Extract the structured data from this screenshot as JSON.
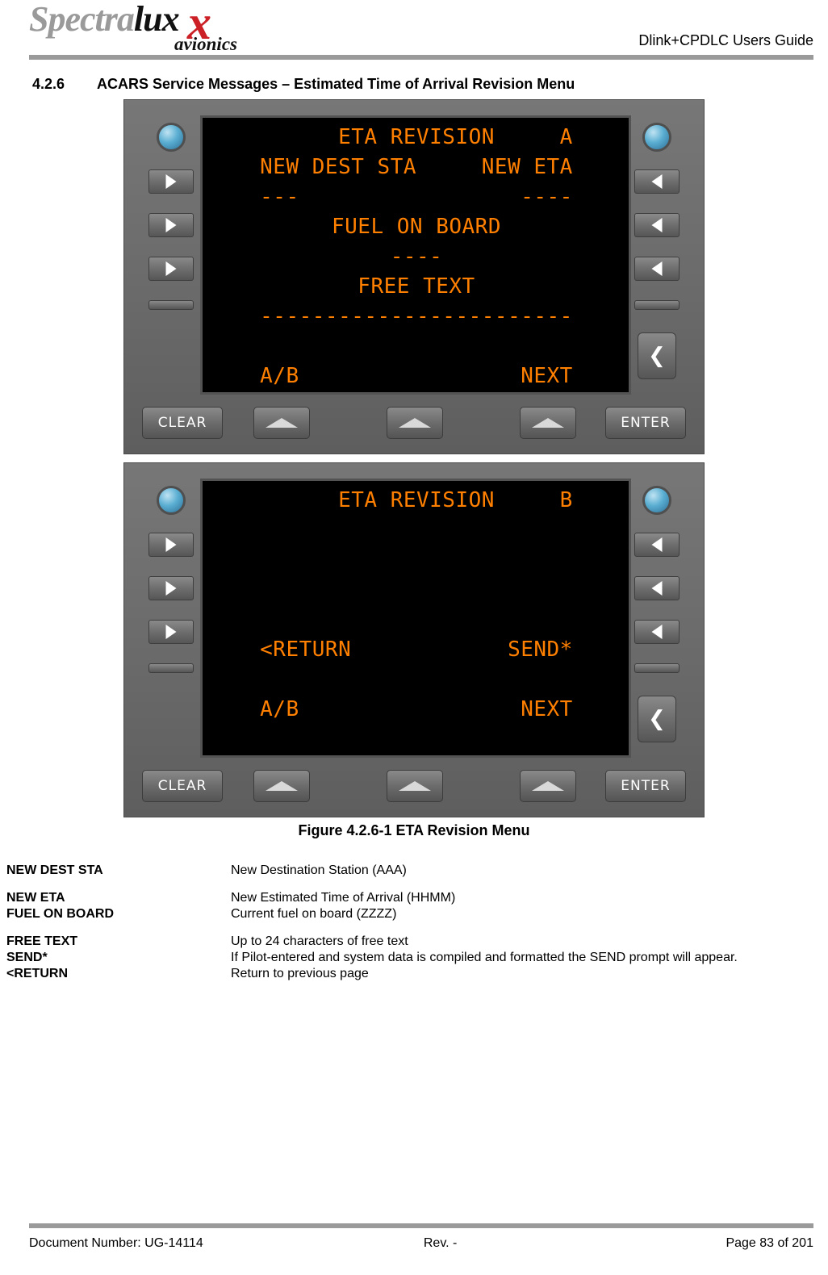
{
  "header": {
    "logo_text": "Spectra",
    "logo_text_bold": "lux",
    "logo_x": "x",
    "logo_sub": "avionics",
    "doc_title": "Dlink+CPDLC Users Guide"
  },
  "section": {
    "number": "4.2.6",
    "title": "ACARS Service Messages – Estimated Time of Arrival Revision Menu"
  },
  "cdu_a": {
    "screen_lines": "      ETA REVISION     A\nNEW DEST STA     NEW ETA\n---                 ----\nFUEL ON BOARD\n----\nFREE TEXT\n------------------------\n\nA/B                 NEXT",
    "clear_label": "CLEAR",
    "enter_label": "ENTER"
  },
  "cdu_b": {
    "screen_lines": "      ETA REVISION     B\n\n\n\n\n<RETURN            SEND*\n\nA/B                 NEXT",
    "clear_label": "CLEAR",
    "enter_label": "ENTER"
  },
  "figure": {
    "caption": "Figure 4.2.6-1 ETA Revision Menu"
  },
  "definitions": [
    {
      "term": "NEW DEST STA",
      "desc": "New Destination Station (AAA)"
    },
    {
      "term": "NEW ETA",
      "desc": "New Estimated Time of Arrival (HHMM)"
    },
    {
      "term": "FUEL ON BOARD",
      "desc": "Current fuel on board (ZZZZ)"
    },
    {
      "term": "FREE TEXT",
      "desc": "Up to 24 characters of free text"
    },
    {
      "term": "SEND*",
      "desc": "If Pilot-entered and system data is compiled and formatted the SEND prompt will appear."
    },
    {
      "term": "<RETURN",
      "desc": "Return to previous page"
    }
  ],
  "footer": {
    "document_number": "Document Number:  UG-14114",
    "revision": "Rev. -",
    "page": "Page 83 of 201"
  }
}
